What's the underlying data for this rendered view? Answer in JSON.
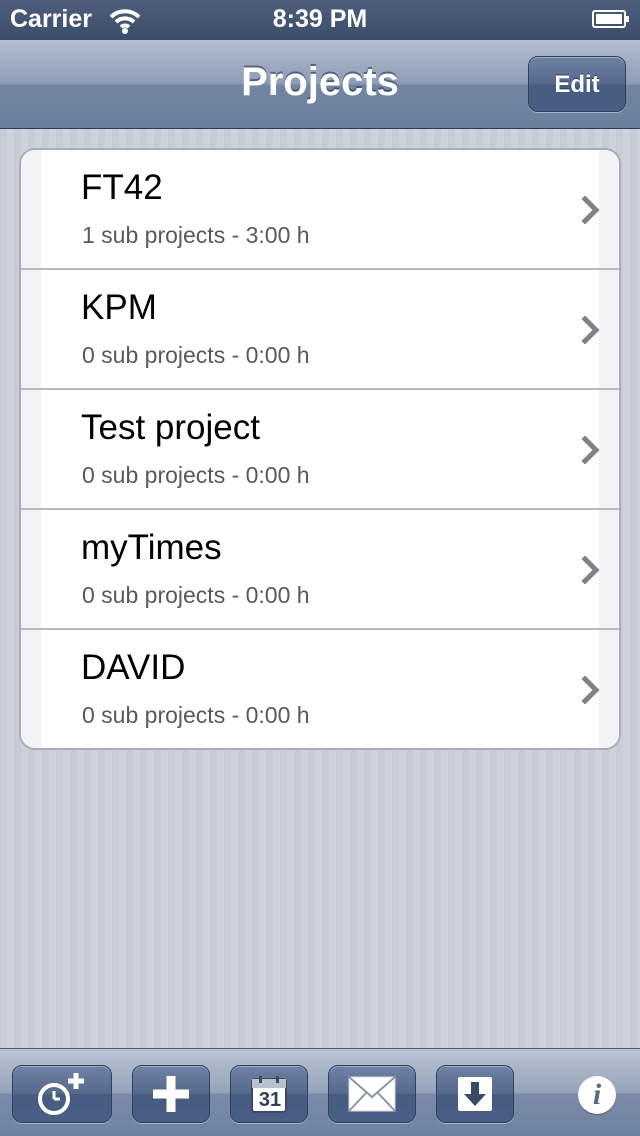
{
  "status_bar": {
    "carrier": "Carrier",
    "time": "8:39 PM",
    "wifi_icon": "wifi-icon",
    "battery_icon": "battery-icon"
  },
  "nav_bar": {
    "title": "Projects",
    "edit_label": "Edit"
  },
  "projects": [
    {
      "name": "FT42",
      "detail": "1 sub projects - 3:00 h"
    },
    {
      "name": "KPM",
      "detail": "0 sub projects - 0:00 h"
    },
    {
      "name": "Test project",
      "detail": "0 sub projects - 0:00 h"
    },
    {
      "name": "myTimes",
      "detail": "0 sub projects - 0:00 h"
    },
    {
      "name": "DAVID",
      "detail": "0 sub projects - 0:00 h"
    }
  ],
  "toolbar": {
    "buttons": [
      {
        "icon": "add-timer-icon"
      },
      {
        "icon": "plus-icon"
      },
      {
        "icon": "calendar-icon",
        "label": "31"
      },
      {
        "icon": "mail-icon"
      },
      {
        "icon": "download-icon"
      }
    ],
    "info": {
      "icon": "info-icon",
      "label": "i"
    }
  },
  "colors": {
    "nav_bar": "#8d9cb5",
    "button": "#55698d",
    "background": "#c9ced8",
    "detail_text": "#555a61"
  }
}
